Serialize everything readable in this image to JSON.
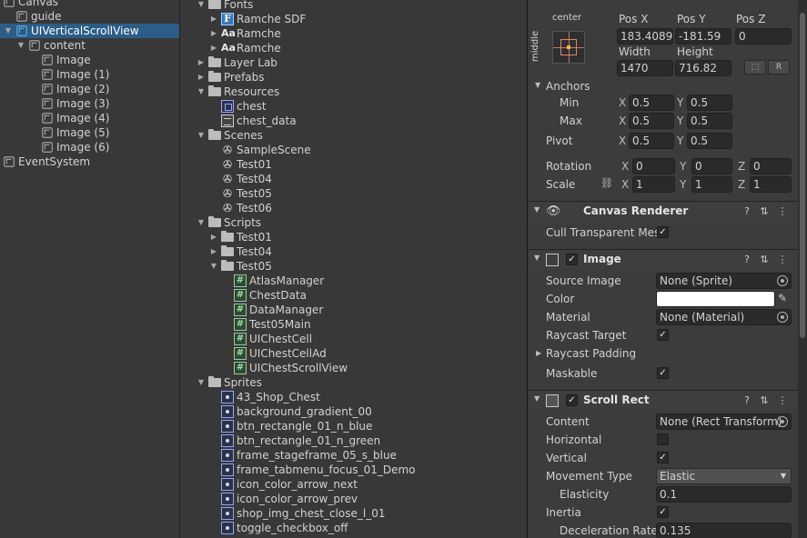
{
  "hierarchy": {
    "items": [
      {
        "label": "Canvas",
        "depth": 0,
        "icon": "cube-icon",
        "expanded": true
      },
      {
        "label": "guide",
        "depth": 1,
        "icon": "cube-icon"
      },
      {
        "label": "UIVerticalScrollView",
        "depth": 1,
        "icon": "cube-icon",
        "expanded": true,
        "selected": true
      },
      {
        "label": "content",
        "depth": 2,
        "icon": "cube-icon",
        "expanded": true
      },
      {
        "label": "Image",
        "depth": 3,
        "icon": "cube-icon"
      },
      {
        "label": "Image (1)",
        "depth": 3,
        "icon": "cube-icon"
      },
      {
        "label": "Image (2)",
        "depth": 3,
        "icon": "cube-icon"
      },
      {
        "label": "Image (3)",
        "depth": 3,
        "icon": "cube-icon"
      },
      {
        "label": "Image (4)",
        "depth": 3,
        "icon": "cube-icon"
      },
      {
        "label": "Image (5)",
        "depth": 3,
        "icon": "cube-icon"
      },
      {
        "label": "Image (6)",
        "depth": 3,
        "icon": "cube-icon"
      },
      {
        "label": "EventSystem",
        "depth": 0,
        "icon": "cube-icon"
      }
    ]
  },
  "project": {
    "items": [
      {
        "label": "Fonts",
        "depth": 0,
        "icon": "folder-icon",
        "expanded": true
      },
      {
        "label": "Ramche SDF",
        "depth": 1,
        "icon": "sdf-font-icon",
        "collapsed": true
      },
      {
        "label": "Ramche",
        "depth": 1,
        "icon": "font-icon",
        "collapsed": true
      },
      {
        "label": "Ramche",
        "depth": 1,
        "icon": "font-icon",
        "collapsed": true
      },
      {
        "label": "Layer Lab",
        "depth": 0,
        "icon": "folder-icon",
        "collapsed": true
      },
      {
        "label": "Prefabs",
        "depth": 0,
        "icon": "folder-icon",
        "collapsed": true
      },
      {
        "label": "Resources",
        "depth": 0,
        "icon": "folder-icon",
        "expanded": true
      },
      {
        "label": "chest",
        "depth": 1,
        "icon": "data-asset-icon"
      },
      {
        "label": "chest_data",
        "depth": 1,
        "icon": "text-asset-icon"
      },
      {
        "label": "Scenes",
        "depth": 0,
        "icon": "folder-icon",
        "expanded": true
      },
      {
        "label": "SampleScene",
        "depth": 1,
        "icon": "scene-icon"
      },
      {
        "label": "Test01",
        "depth": 1,
        "icon": "scene-icon"
      },
      {
        "label": "Test04",
        "depth": 1,
        "icon": "scene-icon"
      },
      {
        "label": "Test05",
        "depth": 1,
        "icon": "scene-icon"
      },
      {
        "label": "Test06",
        "depth": 1,
        "icon": "scene-icon"
      },
      {
        "label": "Scripts",
        "depth": 0,
        "icon": "folder-icon",
        "expanded": true
      },
      {
        "label": "Test01",
        "depth": 1,
        "icon": "folder-icon",
        "collapsed": true
      },
      {
        "label": "Test04",
        "depth": 1,
        "icon": "folder-icon",
        "collapsed": true
      },
      {
        "label": "Test05",
        "depth": 1,
        "icon": "folder-icon",
        "expanded": true
      },
      {
        "label": "AtlasManager",
        "depth": 2,
        "icon": "script-icon"
      },
      {
        "label": "ChestData",
        "depth": 2,
        "icon": "script-icon"
      },
      {
        "label": "DataManager",
        "depth": 2,
        "icon": "script-icon"
      },
      {
        "label": "Test05Main",
        "depth": 2,
        "icon": "script-icon"
      },
      {
        "label": "UIChestCell",
        "depth": 2,
        "icon": "script-icon"
      },
      {
        "label": "UIChestCellAd",
        "depth": 2,
        "icon": "script-icon"
      },
      {
        "label": "UIChestScrollView",
        "depth": 2,
        "icon": "script-icon"
      },
      {
        "label": "Sprites",
        "depth": 0,
        "icon": "folder-icon",
        "expanded": true
      },
      {
        "label": "43_Shop_Chest",
        "depth": 1,
        "icon": "sprite-icon"
      },
      {
        "label": "background_gradient_00",
        "depth": 1,
        "icon": "sprite-icon"
      },
      {
        "label": "btn_rectangle_01_n_blue",
        "depth": 1,
        "icon": "sprite-icon"
      },
      {
        "label": "btn_rectangle_01_n_green",
        "depth": 1,
        "icon": "sprite-icon"
      },
      {
        "label": "frame_stageframe_05_s_blue",
        "depth": 1,
        "icon": "sprite-icon"
      },
      {
        "label": "frame_tabmenu_focus_01_Demo",
        "depth": 1,
        "icon": "sprite-icon"
      },
      {
        "label": "icon_color_arrow_next",
        "depth": 1,
        "icon": "sprite-icon"
      },
      {
        "label": "icon_color_arrow_prev",
        "depth": 1,
        "icon": "sprite-icon"
      },
      {
        "label": "shop_img_chest_close_l_01",
        "depth": 1,
        "icon": "sprite-icon"
      },
      {
        "label": "toggle_checkbox_off",
        "depth": 1,
        "icon": "sprite-icon"
      }
    ]
  },
  "inspector": {
    "rect_transform": {
      "anchor_preset_h": "center",
      "anchor_preset_v": "middle",
      "pos_x_label": "Pos X",
      "pos_y_label": "Pos Y",
      "pos_z_label": "Pos Z",
      "pos_x": "183.4089",
      "pos_y": "-181.59",
      "pos_z": "0",
      "width_label": "Width",
      "height_label": "Height",
      "width": "1470",
      "height": "716.82",
      "blueprint_btn": "⬚",
      "raw_btn": "R",
      "anchors_label": "Anchors",
      "min_label": "Min",
      "max_label": "Max",
      "min_x": "0.5",
      "min_y": "0.5",
      "max_x": "0.5",
      "max_y": "0.5",
      "pivot_label": "Pivot",
      "pivot_x": "0.5",
      "pivot_y": "0.5",
      "rotation_label": "Rotation",
      "rot_x": "0",
      "rot_y": "0",
      "rot_z": "0",
      "scale_label": "Scale",
      "scale_x": "1",
      "scale_y": "1",
      "scale_z": "1",
      "axis_x": "X",
      "axis_y": "Y",
      "axis_z": "Z"
    },
    "canvas_renderer": {
      "title": "Canvas Renderer",
      "cull_label": "Cull Transparent Mes",
      "cull_checked": true
    },
    "image": {
      "title": "Image",
      "source_image_label": "Source Image",
      "source_image": "None (Sprite)",
      "color_label": "Color",
      "color_value": "#ffffff",
      "material_label": "Material",
      "material": "None (Material)",
      "raycast_target_label": "Raycast Target",
      "raycast_target": true,
      "raycast_padding_label": "Raycast Padding",
      "maskable_label": "Maskable",
      "maskable": true
    },
    "scroll_rect": {
      "title": "Scroll Rect",
      "content_label": "Content",
      "content": "None (Rect Transform)",
      "horizontal_label": "Horizontal",
      "horizontal": false,
      "vertical_label": "Vertical",
      "vertical": true,
      "movement_type_label": "Movement Type",
      "movement_type": "Elastic",
      "elasticity_label": "Elasticity",
      "elasticity": "0.1",
      "inertia_label": "Inertia",
      "inertia": true,
      "deceleration_label": "Deceleration Rate",
      "deceleration": "0.135"
    },
    "header_icons": {
      "help": "?",
      "settings": "⇅",
      "menu": "⋮"
    }
  }
}
